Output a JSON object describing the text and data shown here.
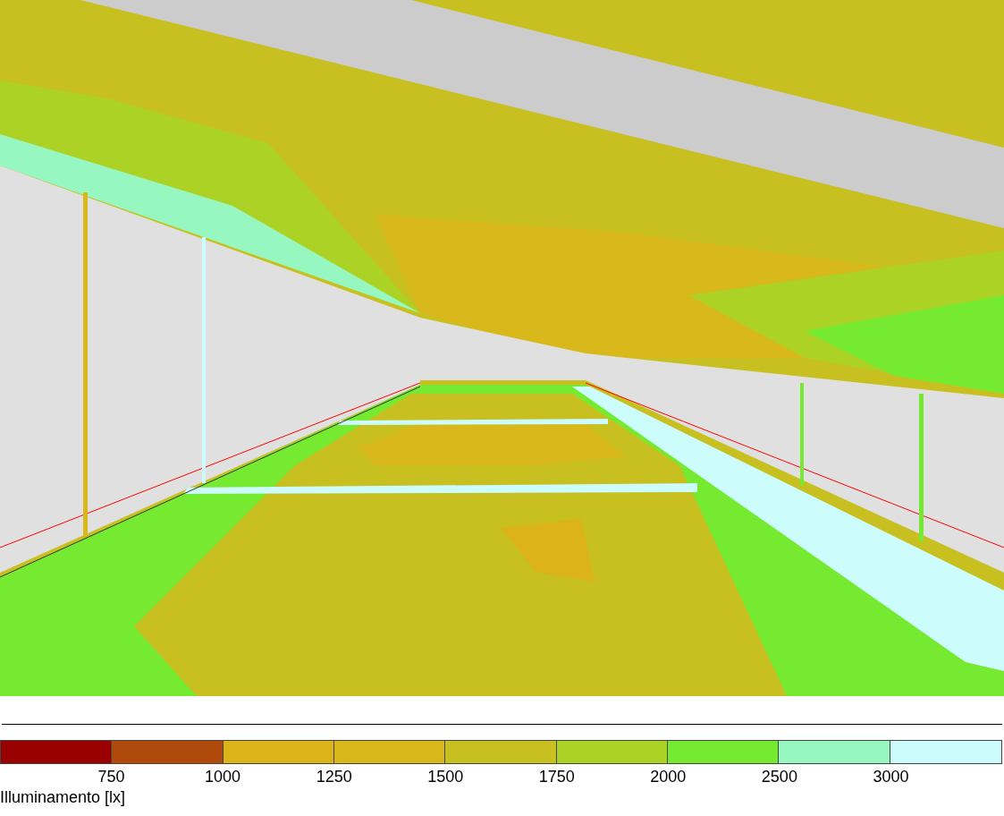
{
  "legend": {
    "bins": [
      {
        "color": "#990000"
      },
      {
        "color": "#b04a0c"
      },
      {
        "color": "#ddb31a"
      },
      {
        "color": "#d8b81a"
      },
      {
        "color": "#c8c020"
      },
      {
        "color": "#add226"
      },
      {
        "color": "#76ea30"
      },
      {
        "color": "#96f8c0"
      },
      {
        "color": "#ccfcfc"
      }
    ],
    "thresholds": [
      "750",
      "1000",
      "1250",
      "1500",
      "1750",
      "2000",
      "2500",
      "3000"
    ],
    "title": "Illuminamento [lx]"
  }
}
